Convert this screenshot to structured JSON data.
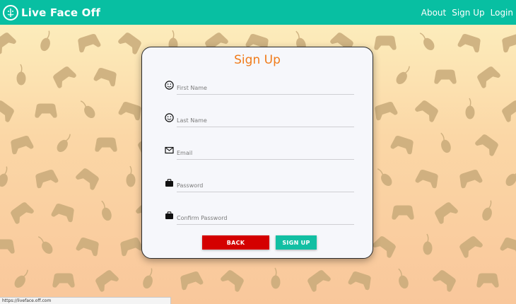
{
  "navbar": {
    "brand": "Live Face Off",
    "links": [
      "About",
      "Sign Up",
      "Login"
    ]
  },
  "form": {
    "title": "Sign Up",
    "fields": [
      {
        "placeholder": "First Name",
        "icon": "smiley-icon"
      },
      {
        "placeholder": "Last Name",
        "icon": "smiley-icon"
      },
      {
        "placeholder": "Email",
        "icon": "envelope-icon"
      },
      {
        "placeholder": "Password",
        "icon": "briefcase-icon"
      },
      {
        "placeholder": "Confirm Password",
        "icon": "briefcase-icon"
      }
    ],
    "back_label": "BACK",
    "signup_label": "SIGN UP"
  },
  "status_url": "https://liveface.off.com",
  "colors": {
    "navbar": "#08bfa2",
    "title": "#f07b1a",
    "back": "#d40000",
    "signup": "#12bfa3",
    "pattern": "#c9ab7a"
  }
}
